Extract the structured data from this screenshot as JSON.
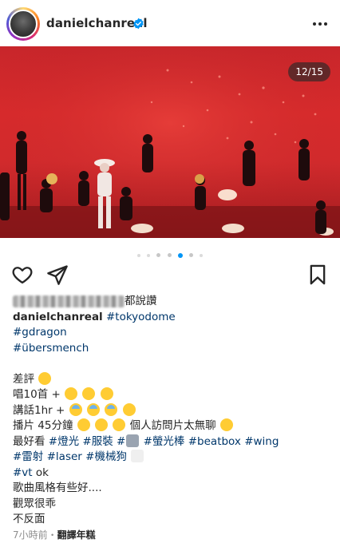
{
  "header": {
    "username": "danielchanreal",
    "verified_icon": "verified-badge-icon",
    "more_icon": "more-options-icon"
  },
  "media": {
    "counter": "12/15",
    "carousel_total": 15,
    "carousel_current": 12
  },
  "actions": {
    "like_icon": "heart-icon",
    "share_icon": "send-icon",
    "save_icon": "bookmark-icon"
  },
  "likes_suffix": "都說讚",
  "caption": {
    "author": "danielchanreal",
    "hashtag_1": "#tokyodome",
    "hashtag_2": "#gdragon",
    "hashtag_3": "#übersmench",
    "line_1": "差評",
    "line_2": "唱10首 +",
    "line_3": "講話1hr +",
    "line_4": "播片 45分鐘",
    "line_4_tail": "個人訪問片太無聊",
    "line_5_prefix": "最好看",
    "line_5_tag_1": "#燈光",
    "line_5_tag_2": "#服裝",
    "line_5_tag_3": "#",
    "line_5_tag_4": "#螢光棒",
    "line_5_tag_5": "#beatbox",
    "line_5_tag_6": "#wing",
    "line_6_tag_1": "#雷射",
    "line_6_tag_2": "#laser",
    "line_6_tag_3": "#機械狗",
    "line_7_tag": "#vt",
    "line_7_text": "ok",
    "line_8": "歌曲風格有些好....",
    "line_9": "觀眾很乖",
    "line_10": "不反面"
  },
  "footer": {
    "time": "7小時前",
    "separator": "・",
    "translate": "翻譯年糕"
  },
  "colors": {
    "accent": "#0095f6",
    "hashtag": "#00376b",
    "muted": "#8e8e8e",
    "stage_red": "#d32b2d"
  }
}
